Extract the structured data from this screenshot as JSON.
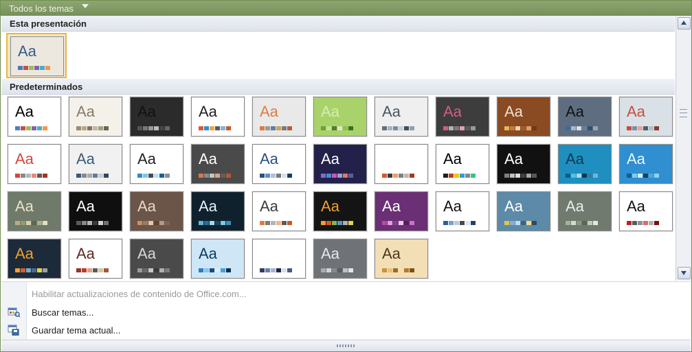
{
  "header": {
    "title": "Todos los temas"
  },
  "sections": {
    "current": "Esta presentación",
    "defaults": "Predeterminados"
  },
  "current_theme": {
    "label": "Aa",
    "bg": "#ece8df",
    "fg": "#3a5a8a",
    "swatches": [
      "#4f7ab2",
      "#c0504d",
      "#9bbb59",
      "#8064a2",
      "#4bacc6",
      "#f79646"
    ]
  },
  "themes": [
    {
      "bg": "#ffffff",
      "fg": "#000000",
      "swatches": [
        "#4f81bd",
        "#c0504d",
        "#9bbb59",
        "#8064a2",
        "#4bacc6",
        "#f79646"
      ]
    },
    {
      "bg": "#f3f1ea",
      "fg": "#8a7a62",
      "swatches": [
        "#9a8b6e",
        "#b6a982",
        "#7c7764",
        "#c7b99a",
        "#a39c86",
        "#6b6352"
      ]
    },
    {
      "bg": "#2b2b2b",
      "fg": "#111111",
      "swatches": [
        "#555555",
        "#777777",
        "#999999",
        "#bbbbbb",
        "#444444",
        "#666666"
      ]
    },
    {
      "bg": "#ffffff",
      "fg": "#222222",
      "swatches": [
        "#e2572b",
        "#2e8fd6",
        "#f2a33a",
        "#5a5a5a",
        "#7fb3e0",
        "#c85a2a"
      ]
    },
    {
      "bg": "#e9e9e9",
      "fg": "#e07a45",
      "swatches": [
        "#e07a45",
        "#9b9b9b",
        "#5d7fa8",
        "#c8a35a",
        "#7a7a7a",
        "#b45f3a"
      ]
    },
    {
      "bg": "#a9d36a",
      "fg": "#d8edb4",
      "swatches": [
        "#6da23a",
        "#c5e39a",
        "#4f7f2b",
        "#e6e1c8",
        "#8cc152",
        "#3f6b22"
      ]
    },
    {
      "bg": "#efefef",
      "fg": "#4a5560",
      "swatches": [
        "#5b7282",
        "#a6b4bd",
        "#7b8c97",
        "#c6cfd4",
        "#3e4f5b",
        "#8fa1ac"
      ]
    },
    {
      "bg": "#3d3d3d",
      "fg": "#d65a8a",
      "swatches": [
        "#d65a8a",
        "#b2b2b2",
        "#7a7a7a",
        "#e69bb9",
        "#5a5a5a",
        "#999999"
      ]
    },
    {
      "bg": "#8a4a22",
      "fg": "#f1e2cf",
      "swatches": [
        "#e8b45a",
        "#c47a3a",
        "#f1d9a8",
        "#a25a28",
        "#d8a060",
        "#6f3a18"
      ]
    },
    {
      "bg": "#5e6e80",
      "fg": "#111111",
      "swatches": [
        "#3a6aa5",
        "#a8b8cc",
        "#d7dfe8",
        "#6a7e94",
        "#2c4f7c",
        "#8fa6bf"
      ]
    },
    {
      "bg": "#d9e0e6",
      "fg": "#c74e3e",
      "swatches": [
        "#c74e3e",
        "#7d8f9d",
        "#e3a39a",
        "#4b5d6b",
        "#b0bec8",
        "#8a3a2f"
      ]
    },
    {
      "bg": "#ffffff",
      "fg": "#d8463a",
      "swatches": [
        "#d8463a",
        "#888888",
        "#b7b7b7",
        "#e68a80",
        "#5a5a5a",
        "#a33328"
      ]
    },
    {
      "bg": "#f1f1f1",
      "fg": "#3a5a7a",
      "swatches": [
        "#3a5a7a",
        "#888888",
        "#aaaaaa",
        "#5e7e9e",
        "#cccccc",
        "#2a4a6a"
      ]
    },
    {
      "bg": "#ffffff",
      "fg": "#222222",
      "swatches": [
        "#2d8bd1",
        "#7fc3ea",
        "#4a4a4a",
        "#b8dff5",
        "#1f5f8f",
        "#8f8f8f"
      ]
    },
    {
      "bg": "#4a4a4a",
      "fg": "#ffffff",
      "swatches": [
        "#d27a4c",
        "#8a8a8a",
        "#c4c4c4",
        "#e0a27e",
        "#5e5e5e",
        "#b35a30"
      ]
    },
    {
      "bg": "#ffffff",
      "fg": "#2b4f7e",
      "swatches": [
        "#2b4f7e",
        "#5d8fc6",
        "#a9c3e0",
        "#7a7a7a",
        "#d5e2f0",
        "#1e3a60"
      ]
    },
    {
      "bg": "#23214a",
      "fg": "#ffffff",
      "swatches": [
        "#7a6fc9",
        "#4b8ad1",
        "#c45ab0",
        "#9aa0d8",
        "#e07a5f",
        "#5c5c9c"
      ]
    },
    {
      "bg": "#ffffff",
      "fg": "#ffffff",
      "swatches": [
        "#d9542f",
        "#3a3a3a",
        "#ef9a6a",
        "#7f7f7f",
        "#b8b8b8",
        "#a83a1a"
      ]
    },
    {
      "bg": "#ffffff",
      "fg": "#000000",
      "swatches": [
        "#1f1f1f",
        "#c0392b",
        "#f1c40f",
        "#3498db",
        "#7f8c8d",
        "#2ecc71"
      ]
    },
    {
      "bg": "#111111",
      "fg": "#ffffff",
      "swatches": [
        "#7f7f7f",
        "#bfbfbf",
        "#d9d9d9",
        "#404040",
        "#a5a5a5",
        "#595959"
      ]
    },
    {
      "bg": "#1e8fbf",
      "fg": "#0c3a52",
      "swatches": [
        "#0b5d85",
        "#4fc0e8",
        "#a6dcef",
        "#083a55",
        "#2a7fa8",
        "#6fb7d6"
      ]
    },
    {
      "bg": "#2f8fd0",
      "fg": "#e8f6ff",
      "swatches": [
        "#0f5f94",
        "#7ccbf2",
        "#d6eefa",
        "#1a3f5f",
        "#4aa8dc",
        "#8fd2f0"
      ]
    },
    {
      "bg": "#6f7a6a",
      "fg": "#e8e3c9",
      "swatches": [
        "#b9ad7e",
        "#8f9a7a",
        "#d8cfa8",
        "#5c6650",
        "#a7b28f",
        "#e6dfbf"
      ]
    },
    {
      "bg": "#0f0f0f",
      "fg": "#ffffff",
      "swatches": [
        "#5a5a5a",
        "#8a8a8a",
        "#b5b5b5",
        "#3a3a3a",
        "#d0d0d0",
        "#707070"
      ]
    },
    {
      "bg": "#6b5548",
      "fg": "#e8d8c8",
      "swatches": [
        "#c88f6a",
        "#9c7a64",
        "#e3c6ac",
        "#5a4436",
        "#b59a86",
        "#7f6252"
      ]
    },
    {
      "bg": "#10212e",
      "fg": "#e8f2f8",
      "swatches": [
        "#5fb8e0",
        "#2c6f92",
        "#a6d8ef",
        "#18465f",
        "#7fc8e8",
        "#3a8fb8"
      ]
    },
    {
      "bg": "#ffffff",
      "fg": "#3a3a3a",
      "swatches": [
        "#e07a45",
        "#7a7a7a",
        "#b3b3b3",
        "#f2b38a",
        "#5a5a5a",
        "#c45a2a"
      ]
    },
    {
      "bg": "#141414",
      "fg": "#f0a030",
      "swatches": [
        "#f0a030",
        "#d85a2a",
        "#7fb84a",
        "#4a9ad0",
        "#b0b0b0",
        "#e8d24a"
      ]
    },
    {
      "bg": "#6a2f74",
      "fg": "#ffffff",
      "swatches": [
        "#b54aa8",
        "#e1a0d8",
        "#7f3f8f",
        "#f2c4ec",
        "#4f2156",
        "#d070c4"
      ]
    },
    {
      "bg": "#ffffff",
      "fg": "#111111",
      "swatches": [
        "#2a5f9e",
        "#7a9cc6",
        "#b6c9e0",
        "#4a4a4a",
        "#dfe7f1",
        "#1c4273"
      ]
    },
    {
      "bg": "#5d8aa8",
      "fg": "#ffffff",
      "swatches": [
        "#e8c34a",
        "#86b1cc",
        "#c7dceb",
        "#3a6280",
        "#f2d98a",
        "#2a4a62"
      ]
    },
    {
      "bg": "#707a6e",
      "fg": "#ececec",
      "swatches": [
        "#a7b39c",
        "#d4dccc",
        "#8a9484",
        "#5c6658",
        "#c2cbb8",
        "#e6ebe0"
      ]
    },
    {
      "bg": "#ffffff",
      "fg": "#111111",
      "swatches": [
        "#c0201f",
        "#5a5a5a",
        "#8f8f8f",
        "#e06a5a",
        "#b0b0b0",
        "#7a1010"
      ]
    },
    {
      "bg": "#1c2a3a",
      "fg": "#f0a030",
      "swatches": [
        "#f0a030",
        "#d85a2a",
        "#7fa8c8",
        "#4a6a8a",
        "#e8d24a",
        "#a0a0a0"
      ]
    },
    {
      "bg": "#ffffff",
      "fg": "#5a2a1a",
      "swatches": [
        "#8a3a2a",
        "#c0392b",
        "#e6a07a",
        "#5a5a5a",
        "#d4c4a4",
        "#a05a3a"
      ]
    },
    {
      "bg": "#4a4a4a",
      "fg": "#d8d8d8",
      "swatches": [
        "#9a9a9a",
        "#6a6a6a",
        "#c6c6c6",
        "#3a3a3a",
        "#b0b0b0",
        "#7c7c7c"
      ]
    },
    {
      "bg": "#cfe6f6",
      "fg": "#0c3a5e",
      "swatches": [
        "#2a7fc0",
        "#8cc4ea",
        "#1b4f7a",
        "#d9eef9",
        "#4aa0d8",
        "#0f2f4a"
      ]
    },
    {
      "bg": "#ffffff",
      "fg": "#ffffff",
      "swatches": [
        "#2f3e5a",
        "#6a7ea8",
        "#a6b4d0",
        "#1c2840",
        "#d7deeb",
        "#4a5a7e"
      ]
    },
    {
      "bg": "#6f7378",
      "fg": "#e8e8e8",
      "swatches": [
        "#a8aeb6",
        "#d0d4d9",
        "#848a92",
        "#5a5f66",
        "#bcc2c9",
        "#e4e7ea"
      ]
    },
    {
      "bg": "#f3dfb6",
      "fg": "#4a3a1a",
      "swatches": [
        "#c8943a",
        "#e8c27a",
        "#9a6a2a",
        "#f5dfae",
        "#b47a32",
        "#7a5220"
      ]
    }
  ],
  "menu": [
    {
      "label": "Habilitar actualizaciones de contenido de Office.com...",
      "enabled": false
    },
    {
      "label": "Buscar temas...",
      "enabled": true
    },
    {
      "label": "Guardar tema actual...",
      "enabled": true
    }
  ]
}
